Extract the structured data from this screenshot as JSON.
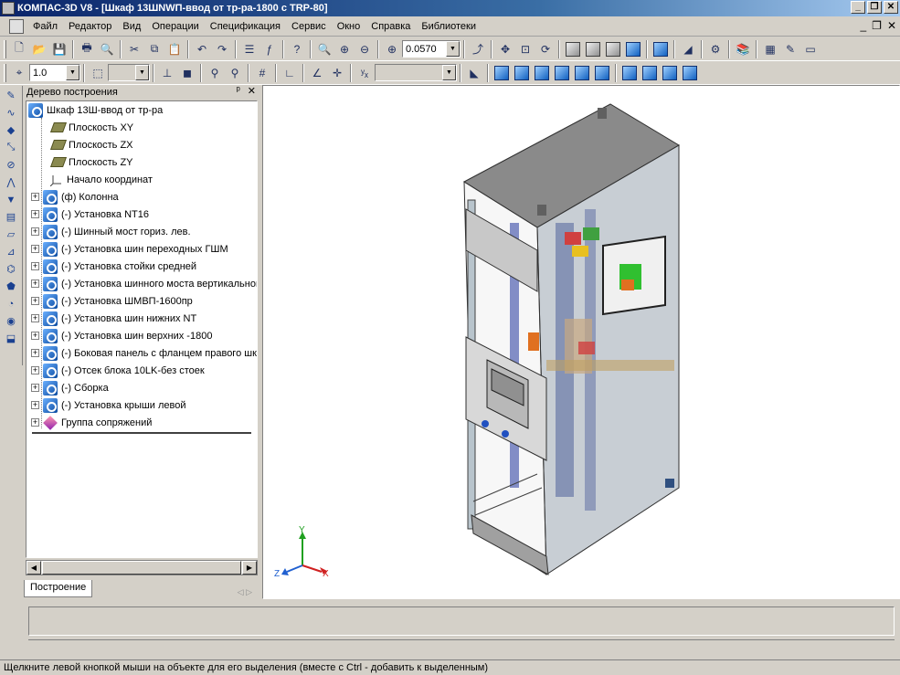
{
  "window": {
    "title": "КОМПАС-3D V8 - [Шкаф 13ШNWП-ввод от тр-ра-1800 с TRP-80]",
    "buttons": [
      "_",
      "❐",
      "✕"
    ]
  },
  "menubar": {
    "items": [
      "Файл",
      "Редактор",
      "Вид",
      "Операции",
      "Спецификация",
      "Сервис",
      "Окно",
      "Справка",
      "Библиотеки"
    ],
    "mdi_controls": [
      "_",
      "❐",
      "✕"
    ]
  },
  "toolbar1": {
    "zoom_value": "0.0570"
  },
  "toolbar2": {
    "scale_value": "1.0"
  },
  "panel": {
    "title": "Дерево построения",
    "pin": "ᵖ",
    "close": "✕",
    "tab_label": "Построение"
  },
  "tree": {
    "root": "Шкаф 13Ш-ввод от тр-ра",
    "items": [
      {
        "label": "Плоскость XY",
        "icon": "plane-icon",
        "expandable": false
      },
      {
        "label": "Плоскость ZX",
        "icon": "plane-icon",
        "expandable": false
      },
      {
        "label": "Плоскость ZY",
        "icon": "plane-icon",
        "expandable": false
      },
      {
        "label": "Начало координат",
        "icon": "origin-icon",
        "expandable": false
      },
      {
        "label": "(ф) Колонна",
        "icon": "component-icon",
        "expandable": true
      },
      {
        "label": "(-) Установка NT16",
        "icon": "component-icon",
        "expandable": true
      },
      {
        "label": "(-) Шинный мост гориз. лев.",
        "icon": "component-icon",
        "expandable": true
      },
      {
        "label": "(-) Установка шин переходных ГШМ",
        "icon": "component-icon",
        "expandable": true
      },
      {
        "label": "(-) Установка стойки средней",
        "icon": "component-icon",
        "expandable": true
      },
      {
        "label": "(-) Установка шинного моста вертикальног",
        "icon": "component-icon",
        "expandable": true
      },
      {
        "label": "(-) Установка ШМВП-1600пр",
        "icon": "component-icon",
        "expandable": true
      },
      {
        "label": "(-) Установка шин нижних NT",
        "icon": "component-icon",
        "expandable": true
      },
      {
        "label": "(-) Установка шин верхних  -1800",
        "icon": "component-icon",
        "expandable": true
      },
      {
        "label": "(-) Боковая панель с фланцем правого шк",
        "icon": "component-icon",
        "expandable": true
      },
      {
        "label": "(-) Отсек блока 10LK-без стоек",
        "icon": "component-icon",
        "expandable": true
      },
      {
        "label": "(-) Сборка",
        "icon": "component-icon",
        "expandable": true
      },
      {
        "label": "(-) Установка крыши левой",
        "icon": "component-icon",
        "expandable": true
      },
      {
        "label": "Группа сопряжений",
        "icon": "mates-icon",
        "expandable": true
      }
    ]
  },
  "axes": {
    "x": "X",
    "y": "Y",
    "z": "Z"
  },
  "status": {
    "text": "Щелкните левой кнопкой мыши на объекте для его выделения (вместе с Ctrl - добавить к выделенным)"
  }
}
